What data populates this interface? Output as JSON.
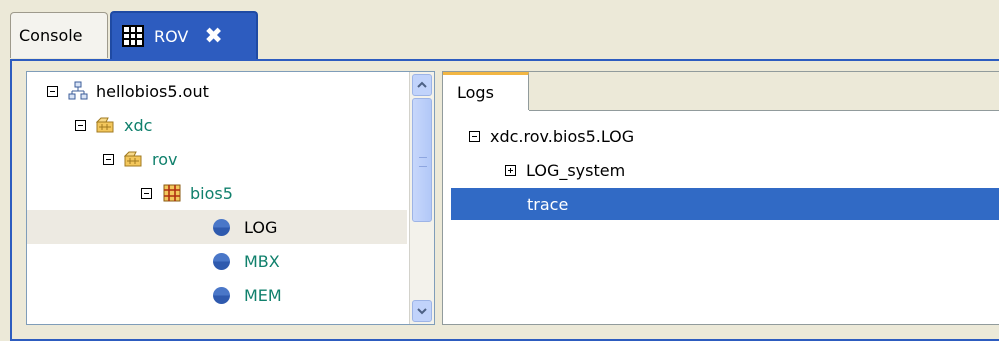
{
  "tabs": [
    {
      "label": "Console",
      "active": false
    },
    {
      "label": "ROV",
      "active": true,
      "close": "✖"
    }
  ],
  "tree": {
    "items": [
      {
        "label": "hellobios5.out",
        "icon": "program-icon",
        "expanded": true
      },
      {
        "label": "xdc",
        "icon": "package-icon",
        "expanded": true
      },
      {
        "label": "rov",
        "icon": "package-icon",
        "expanded": true
      },
      {
        "label": "bios5",
        "icon": "module-grid-icon",
        "expanded": true
      },
      {
        "label": "LOG",
        "icon": "module-dot-icon",
        "selected": true
      },
      {
        "label": "MBX",
        "icon": "module-dot-icon"
      },
      {
        "label": "MEM",
        "icon": "module-dot-icon"
      }
    ]
  },
  "view": {
    "tab_label": "Logs",
    "rows": [
      {
        "label": "xdc.rov.bios5.LOG",
        "expander": "minus"
      },
      {
        "label": "LOG_system",
        "expander": "plus"
      },
      {
        "label": "trace",
        "selected": true
      }
    ]
  },
  "colors": {
    "tab_active": "#2D5CBF",
    "selection": "#316AC5",
    "green_text": "#10806C",
    "logs_tab_accent": "#F2B643"
  }
}
